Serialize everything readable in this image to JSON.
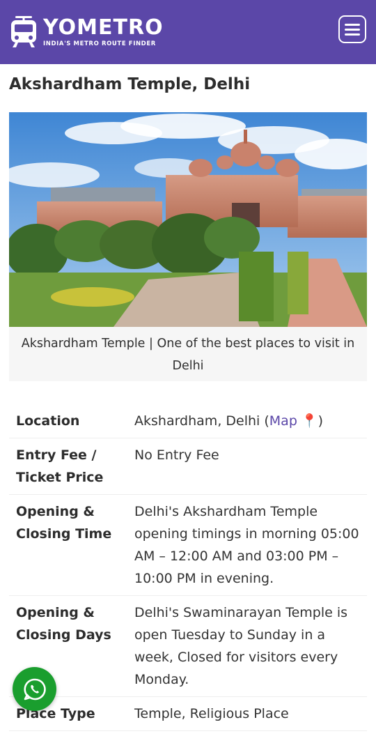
{
  "header": {
    "brand_name": "YOMETRO",
    "brand_tagline": "INDIA'S METRO ROUTE FINDER",
    "brand_icon": "metro-train-icon",
    "menu_icon": "hamburger-menu-icon",
    "background_color": "#5b47a8"
  },
  "page": {
    "title": "Akshardham Temple, Delhi"
  },
  "figure": {
    "caption": "Akshardham Temple | One of the best places to visit in Delhi"
  },
  "info": {
    "location": {
      "label": "Location",
      "value_prefix": "Akshardham, Delhi (",
      "map_link": "Map 📍",
      "value_suffix": ")"
    },
    "rows": [
      {
        "label": "Entry Fee / Ticket Price",
        "value": "No Entry Fee"
      },
      {
        "label": "Opening & Closing Time",
        "value": "Delhi's Akshardham Temple opening timings in morning 05:00 AM – 12:00 AM and 03:00 PM – 10:00 PM in evening."
      },
      {
        "label": "Opening & Closing Days",
        "value": "Delhi's Swaminarayan Temple is open Tuesday to Sunday in a week, Closed for visitors every Monday."
      },
      {
        "label": "Place Type",
        "value": "Temple, Religious Place"
      }
    ]
  },
  "floating": {
    "whatsapp_icon": "whatsapp-icon",
    "whatsapp_color": "#1a9e2e"
  }
}
